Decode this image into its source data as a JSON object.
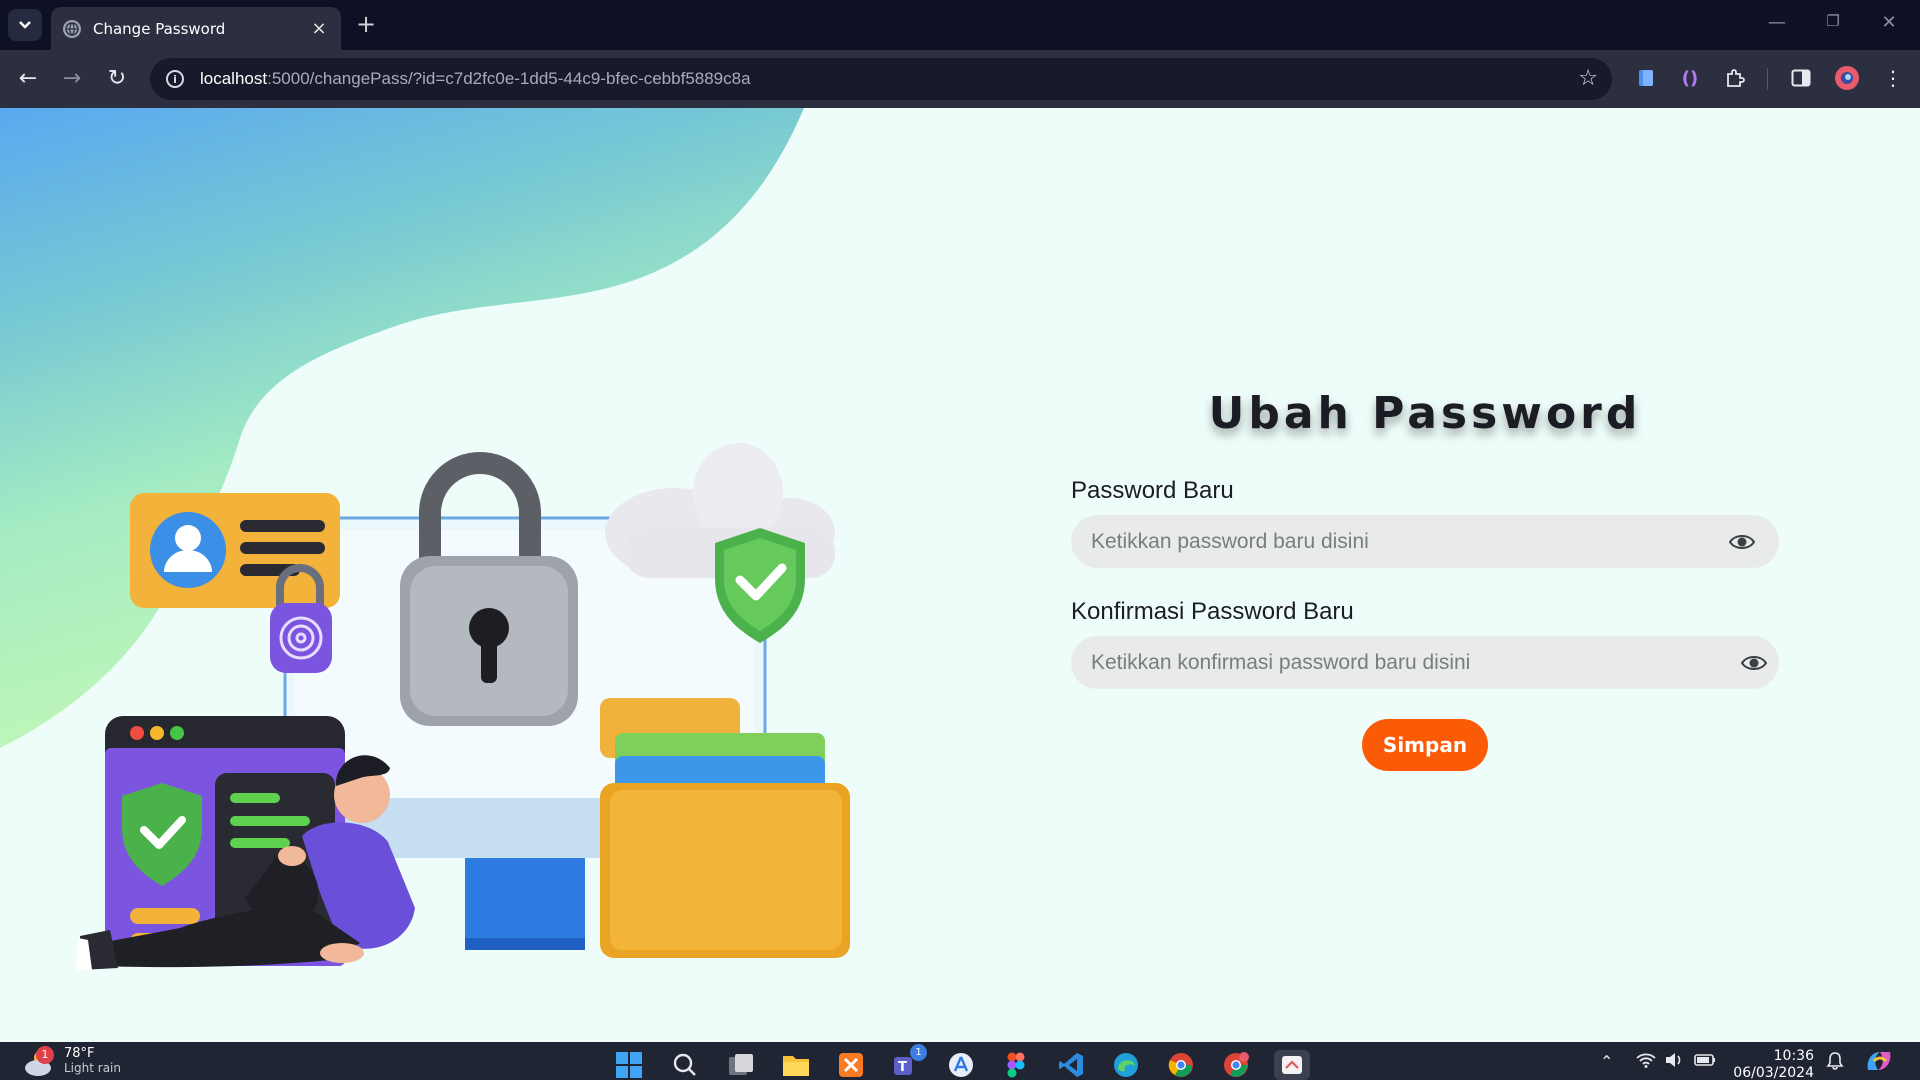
{
  "browser": {
    "tab_title": "Change Password",
    "url_host": "localhost",
    "url_path": ":5000/changePass/?id=c7d2fc0e-1dd5-44c9-bfec-cebbf5889c8a",
    "new_tab_symbol": "+",
    "close_symbol": "×",
    "window_controls": {
      "minimize": "—",
      "maximize": "❐",
      "close": "✕"
    },
    "nav": {
      "back": "←",
      "forward": "→",
      "reload": "↻",
      "bookmark": "☆"
    }
  },
  "page": {
    "title": "Ubah Password",
    "fields": [
      {
        "label": "Password Baru",
        "placeholder": "Ketikkan password baru disini",
        "value": ""
      },
      {
        "label": "Konfirmasi Password Baru",
        "placeholder": "Ketikkan konfirmasi password baru disini",
        "value": ""
      }
    ],
    "submit_label": "Simpan",
    "colors": {
      "background": "#eefdfa",
      "accent_button": "#fb5a06",
      "blob_gradient_top": "#5aa8f0",
      "blob_gradient_bottom": "#b6f7b8",
      "input_background": "#e9ebea"
    },
    "illustration": "security-illustration"
  },
  "taskbar": {
    "weather_temp": "78°F",
    "weather_desc": "Light rain",
    "weather_badge": "1",
    "teams_badge": "1",
    "time": "10:36",
    "date": "06/03/2024",
    "apps": [
      "start",
      "search",
      "task-view",
      "file-explorer",
      "xampp",
      "teams",
      "app-store",
      "figma",
      "vscode",
      "edge",
      "chrome",
      "chrome-profile",
      "snipping-tool"
    ]
  }
}
